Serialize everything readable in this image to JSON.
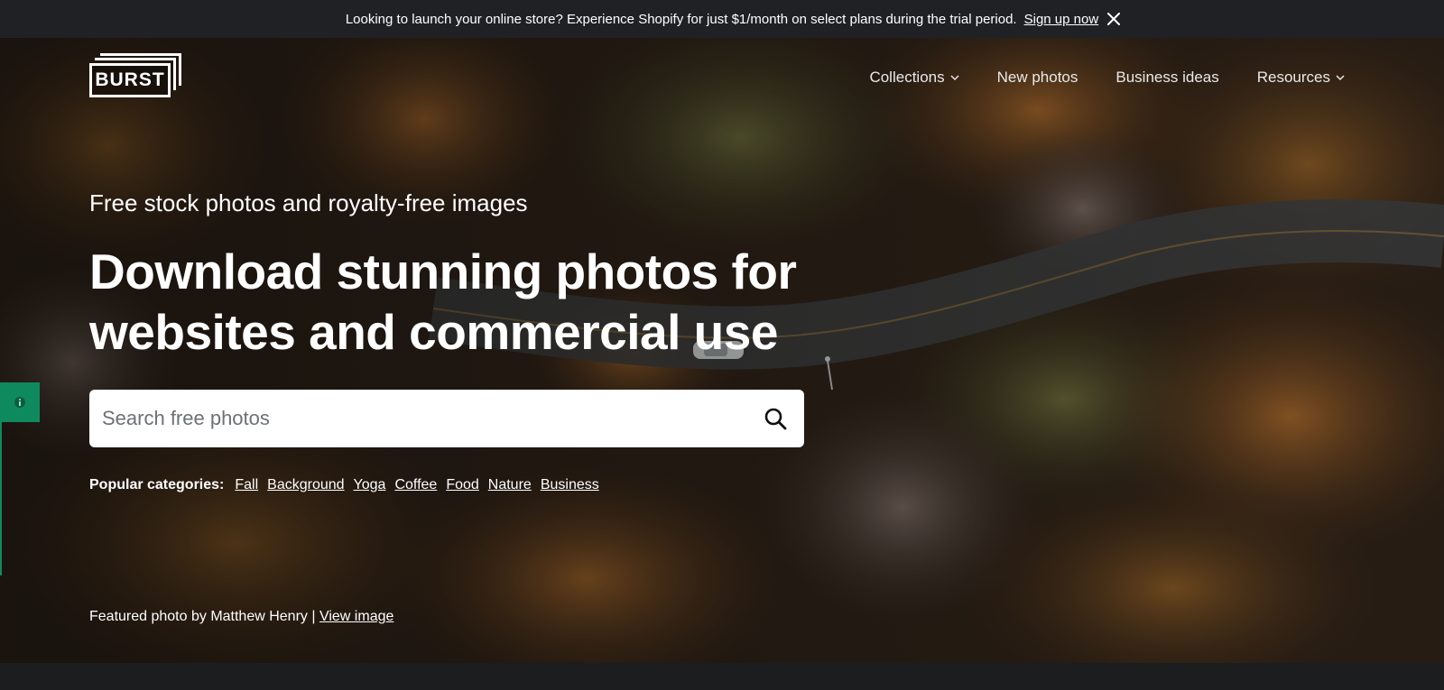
{
  "announcement": {
    "message": "Looking to launch your online store? Experience Shopify for just $1/month on select plans during the trial period.",
    "link": "Sign up now"
  },
  "header": {
    "logo": "BURST",
    "nav": [
      {
        "label": "Collections",
        "icon": "chevron-down-icon"
      },
      {
        "label": "New photos"
      },
      {
        "label": "Business ideas"
      },
      {
        "label": "Resources",
        "icon": "chevron-down-icon"
      }
    ]
  },
  "hero": {
    "tagline": "Free stock photos and royalty-free images",
    "headline": "Download stunning photos for websites and commercial use",
    "search": {
      "placeholder": "Search free photos",
      "value": ""
    },
    "categories": {
      "label": "Popular categories:",
      "items": [
        "Fall",
        "Background",
        "Yoga",
        "Coffee",
        "Food",
        "Nature",
        "Business"
      ]
    },
    "featured": {
      "text": "Featured photo by Matthew Henry |",
      "link": "View image"
    }
  },
  "colors": {
    "announcement_bg": "#1f2125",
    "side_tab": "#0f8a5f",
    "text": "#ffffff"
  }
}
